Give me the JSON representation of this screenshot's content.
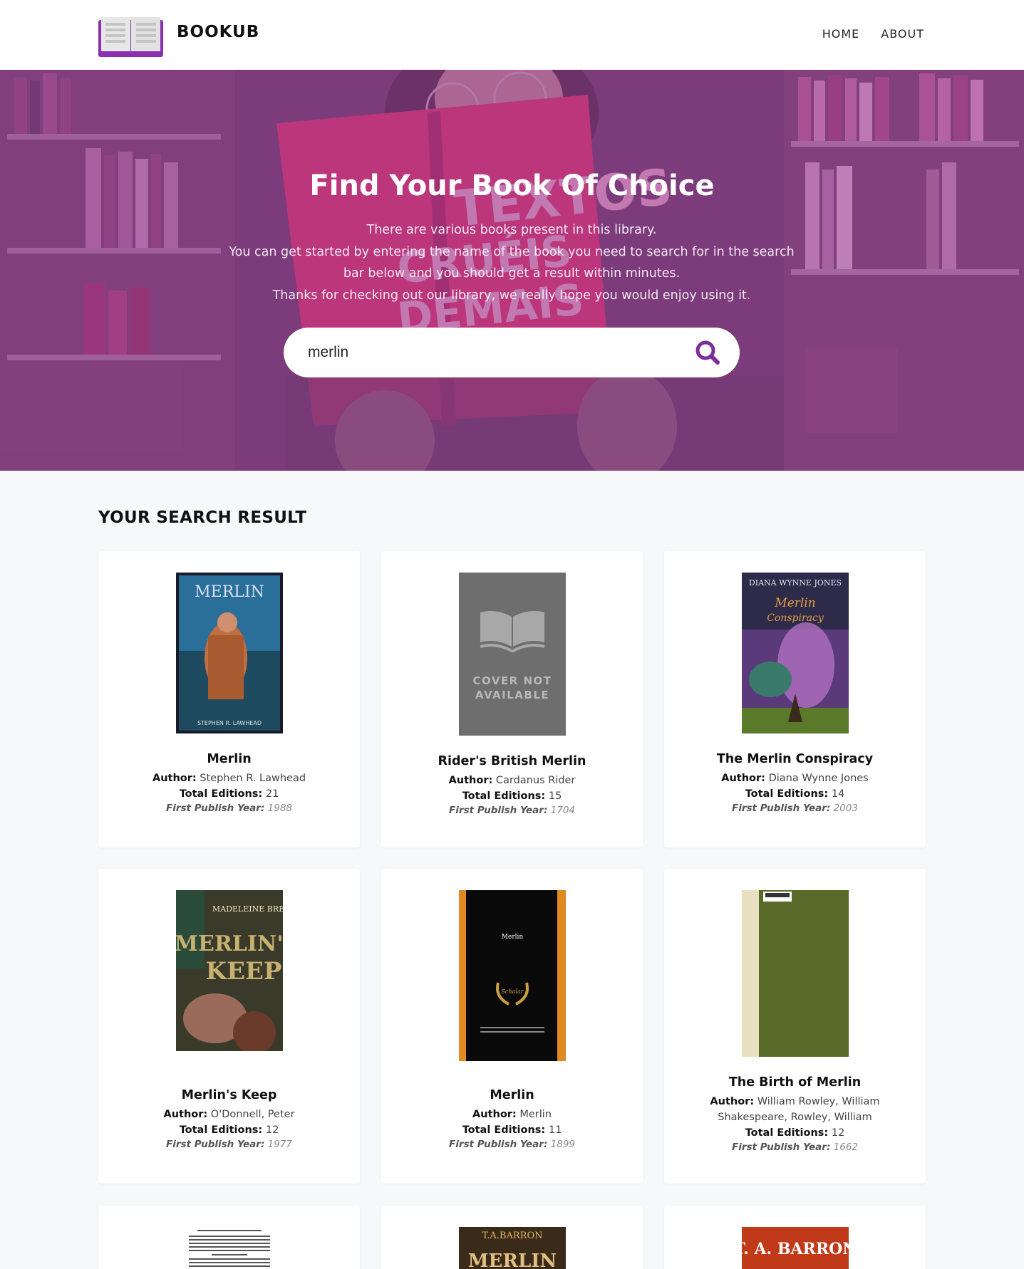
{
  "header": {
    "brand": "BOOKUB",
    "nav": [
      {
        "label": "HOME"
      },
      {
        "label": "ABOUT"
      }
    ]
  },
  "hero": {
    "title": "Find Your Book Of Choice",
    "line1": "There are various books present in this library.",
    "line2": "You can get started by entering the name of the book you need to search for in the search bar below and you should get a result within minutes.",
    "line3": "Thanks for checking out our library, we really hope you would enjoy using it.",
    "search_value": "merlin"
  },
  "results": {
    "title": "YOUR SEARCH RESULT",
    "author_label": "Author:",
    "editions_label": "Total Editions:",
    "year_label": "First Publish Year:",
    "books": [
      {
        "title": "Merlin",
        "author": "Stephen R. Lawhead",
        "editions": "21",
        "year": "1988",
        "cover": "merlin-lawhead",
        "cover_text": "MERLIN",
        "cover_author": "STEPHEN R. LAWHEAD"
      },
      {
        "title": "Rider's British Merlin",
        "author": "Cardanus Rider",
        "editions": "15",
        "year": "1704",
        "cover": "not-available",
        "cover_text": "COVER NOT AVAILABLE"
      },
      {
        "title": "The Merlin Conspiracy",
        "author": "Diana Wynne Jones",
        "editions": "14",
        "year": "2003",
        "cover": "merlin-conspiracy",
        "cover_text": "The Merlin Conspiracy",
        "cover_author": "DIANA WYNNE JONES"
      },
      {
        "title": "Merlin's Keep",
        "author": "O'Donnell, Peter",
        "editions": "12",
        "year": "1977",
        "cover": "merlins-keep",
        "cover_text": "MERLIN'S KEEP",
        "cover_author": "MADELEINE BRENT"
      },
      {
        "title": "Merlin",
        "author": "Merlin",
        "editions": "11",
        "year": "1899",
        "cover": "scholar-select",
        "cover_text": "Merlin"
      },
      {
        "title": "The Birth of Merlin",
        "author": "William Rowley, William Shakespeare, Rowley, William",
        "editions": "12",
        "year": "1662",
        "cover": "green-cloth"
      },
      {
        "cover": "text-page"
      },
      {
        "cover": "barron-mirror",
        "cover_author": "T.A.BARRON",
        "cover_text": "MERLIN"
      },
      {
        "cover": "barron-red",
        "cover_author": "T. A. BARRON"
      }
    ]
  },
  "colors": {
    "accent": "#7b2d9a",
    "overlay": "#963c96",
    "background": "#f7f8fa"
  }
}
